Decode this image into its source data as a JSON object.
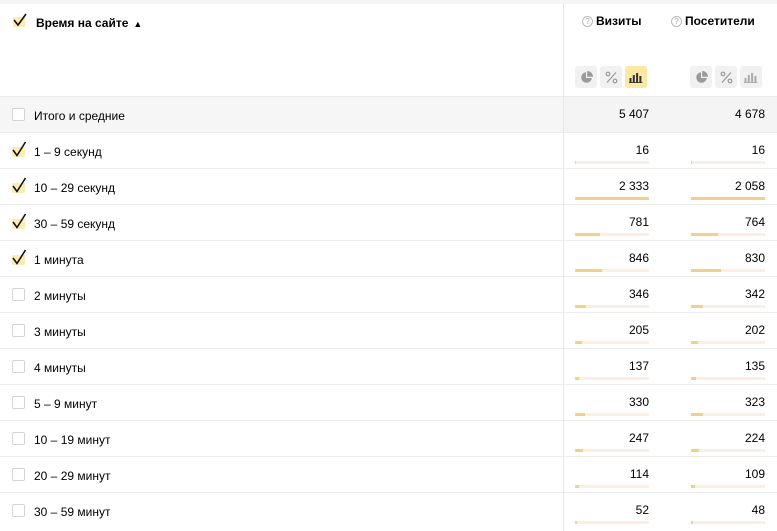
{
  "header": {
    "dimension_title": "Время на сайте",
    "sort_arrow": "▲",
    "metrics": [
      {
        "label": "Визиты",
        "help": "?"
      },
      {
        "label": "Посетители",
        "help": "?"
      }
    ]
  },
  "rows": [
    {
      "label": "Итого и средние",
      "checked": false,
      "total": true,
      "visits": "5 407",
      "visitors": "4 678",
      "visits_frac": 0,
      "visitors_frac": 0
    },
    {
      "label": "1 – 9 секунд",
      "checked": true,
      "visits": "16",
      "visitors": "16",
      "visits_frac": 0.007,
      "visitors_frac": 0.008
    },
    {
      "label": "10 – 29 секунд",
      "checked": true,
      "visits": "2 333",
      "visitors": "2 058",
      "visits_frac": 1.0,
      "visitors_frac": 1.0
    },
    {
      "label": "30 – 59 секунд",
      "checked": true,
      "visits": "781",
      "visitors": "764",
      "visits_frac": 0.335,
      "visitors_frac": 0.371
    },
    {
      "label": "1 минута",
      "checked": true,
      "visits": "846",
      "visitors": "830",
      "visits_frac": 0.363,
      "visitors_frac": 0.403
    },
    {
      "label": "2 минуты",
      "checked": false,
      "visits": "346",
      "visitors": "342",
      "visits_frac": 0.148,
      "visitors_frac": 0.166
    },
    {
      "label": "3 минуты",
      "checked": false,
      "visits": "205",
      "visitors": "202",
      "visits_frac": 0.088,
      "visitors_frac": 0.098
    },
    {
      "label": "4 минуты",
      "checked": false,
      "visits": "137",
      "visitors": "135",
      "visits_frac": 0.059,
      "visitors_frac": 0.066
    },
    {
      "label": "5 – 9 минут",
      "checked": false,
      "visits": "330",
      "visitors": "323",
      "visits_frac": 0.141,
      "visitors_frac": 0.157
    },
    {
      "label": "10 – 19 минут",
      "checked": false,
      "visits": "247",
      "visitors": "224",
      "visits_frac": 0.106,
      "visitors_frac": 0.109
    },
    {
      "label": "20 – 29 минут",
      "checked": false,
      "visits": "114",
      "visitors": "109",
      "visits_frac": 0.049,
      "visitors_frac": 0.053
    },
    {
      "label": "30 – 59 минут",
      "checked": false,
      "visits": "52",
      "visitors": "48",
      "visits_frac": 0.022,
      "visitors_frac": 0.023
    }
  ],
  "colors": {
    "accent": "#fde8a4",
    "bar": "#f2d08a",
    "bar_track": "#fbeee3"
  }
}
